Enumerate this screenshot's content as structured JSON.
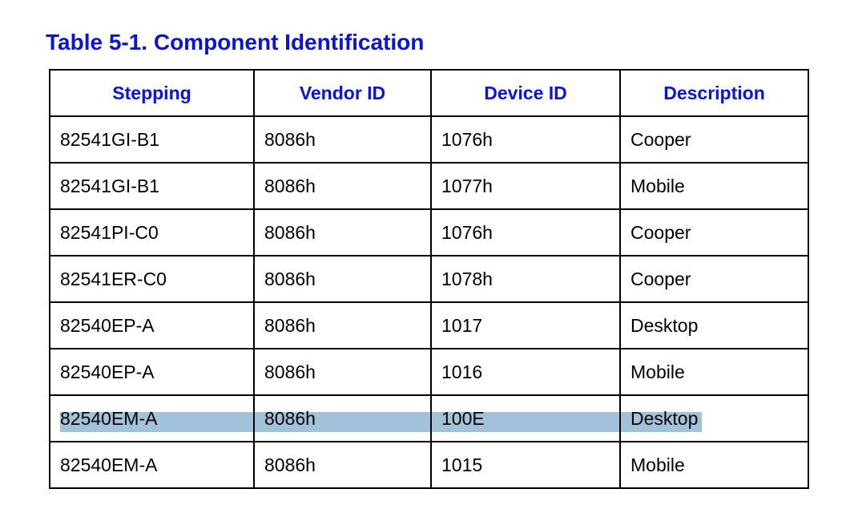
{
  "title": "Table 5-1. Component Identification",
  "table": {
    "headers": [
      "Stepping",
      "Vendor ID",
      "Device ID",
      "Description"
    ],
    "rows": [
      [
        "82541GI-B1",
        "8086h",
        "1076h",
        "Cooper"
      ],
      [
        "82541GI-B1",
        "8086h",
        "1077h",
        "Mobile"
      ],
      [
        "82541PI-C0",
        "8086h",
        "1076h",
        "Cooper"
      ],
      [
        "82541ER-C0",
        "8086h",
        "1078h",
        "Cooper"
      ],
      [
        "82540EP-A",
        "8086h",
        "1017",
        "Desktop"
      ],
      [
        "82540EP-A",
        "8086h",
        "1016",
        "Mobile"
      ],
      [
        "82540EM-A",
        "8086h",
        "100E",
        "Desktop"
      ],
      [
        "82540EM-A",
        "8086h",
        "1015",
        "Mobile"
      ]
    ],
    "highlighted_row": 7
  },
  "colors": {
    "heading": "#0a14d8",
    "border": "#000000",
    "highlight": "#9dbfd8"
  }
}
